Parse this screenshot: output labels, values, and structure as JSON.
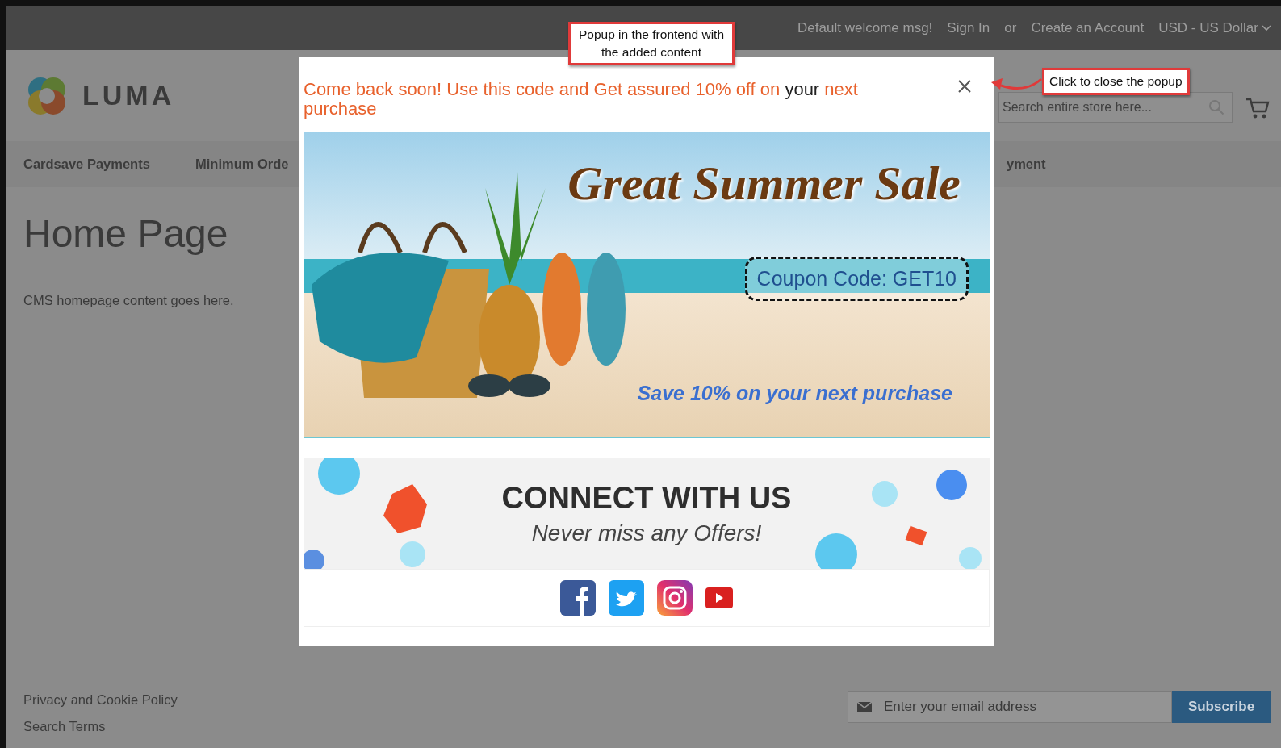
{
  "top_bar": {
    "welcome": "Default welcome msg!",
    "sign_in": "Sign In",
    "separator": "or",
    "create_account": "Create an Account",
    "currency": "USD - US Dollar"
  },
  "header": {
    "logo_text": "LUMA",
    "search": {
      "placeholder": "Search entire store here..."
    }
  },
  "nav": [
    "Cardsave Payments",
    "Minimum Orde",
    "yment"
  ],
  "page": {
    "title": "Home Page",
    "content": "CMS homepage content goes here."
  },
  "popup": {
    "message": [
      {
        "text": "Come back soon! Use this code and Get assured 10% off on ",
        "highlight": true
      },
      {
        "text": "your",
        "highlight": false
      },
      {
        "text": " next purchase",
        "highlight": true
      }
    ],
    "banner": {
      "title": "Great Summer Sale",
      "coupon": "Coupon Code: GET10",
      "tagline": "Save 10% on your next purchase"
    },
    "connect": {
      "title": "CONNECT WITH US",
      "subtitle": "Never miss any Offers!"
    },
    "social": [
      {
        "kind": "facebook"
      },
      {
        "kind": "twitter"
      },
      {
        "kind": "instagram"
      },
      {
        "kind": "youtube"
      }
    ]
  },
  "footer": {
    "links": [
      "Privacy and Cookie Policy",
      "Search Terms"
    ],
    "newsletter": {
      "placeholder": "Enter your email address",
      "button": "Subscribe"
    }
  },
  "annotations": [
    {
      "text": "Popup in the frontend with the added content"
    },
    {
      "text": "Click to close the popup"
    }
  ]
}
